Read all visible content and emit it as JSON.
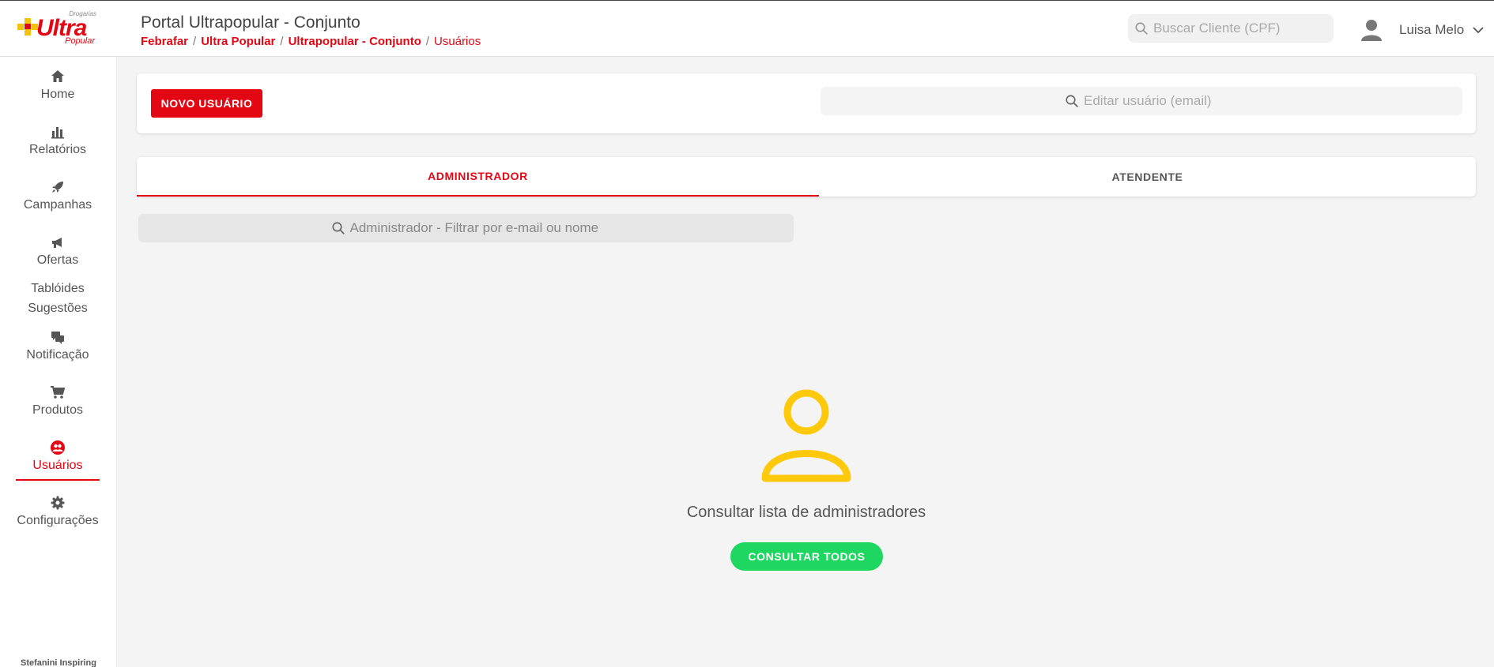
{
  "brand": {
    "top_text": "Drogarias",
    "name": "Ultra",
    "sub_text": "Popular",
    "colors": {
      "primary": "#e30613",
      "accent": "#f4c20d",
      "success": "#1ed760"
    }
  },
  "header": {
    "title": "Portal Ultrapopular - Conjunto",
    "breadcrumb": [
      "Febrafar",
      "Ultra Popular",
      "Ultrapopular - Conjunto",
      "Usuários"
    ],
    "breadcrumb_separator": "/",
    "client_search_placeholder": "Buscar Cliente (CPF)",
    "user_name": "Luisa Melo"
  },
  "sidebar": {
    "items": [
      {
        "label": "Home",
        "icon": "home-icon"
      },
      {
        "label": "Relatórios",
        "icon": "bar-chart-icon"
      },
      {
        "label": "Campanhas",
        "icon": "rocket-icon"
      },
      {
        "label": "Ofertas",
        "icon": "megaphone-icon"
      },
      {
        "label": "Tablóides"
      },
      {
        "label": "Sugestões"
      },
      {
        "label": "Notificação",
        "icon": "chat-icon"
      },
      {
        "label": "Produtos",
        "icon": "cart-icon"
      },
      {
        "label": "Usuários",
        "icon": "users-icon",
        "active": true
      },
      {
        "label": "Configurações",
        "icon": "gear-icon"
      }
    ],
    "footer": "Stefanini Inspiring"
  },
  "actions": {
    "new_user_label": "NOVO USUÁRIO",
    "edit_user_placeholder": "Editar usuário (email)"
  },
  "tabs": [
    {
      "label": "ADMINISTRADOR",
      "active": true
    },
    {
      "label": "ATENDENTE",
      "active": false
    }
  ],
  "filter": {
    "placeholder": "Administrador - Filtrar por e-mail ou nome"
  },
  "empty_state": {
    "icon": "user-icon",
    "message": "Consultar lista de administradores",
    "button_label": "CONSULTAR TODOS"
  }
}
